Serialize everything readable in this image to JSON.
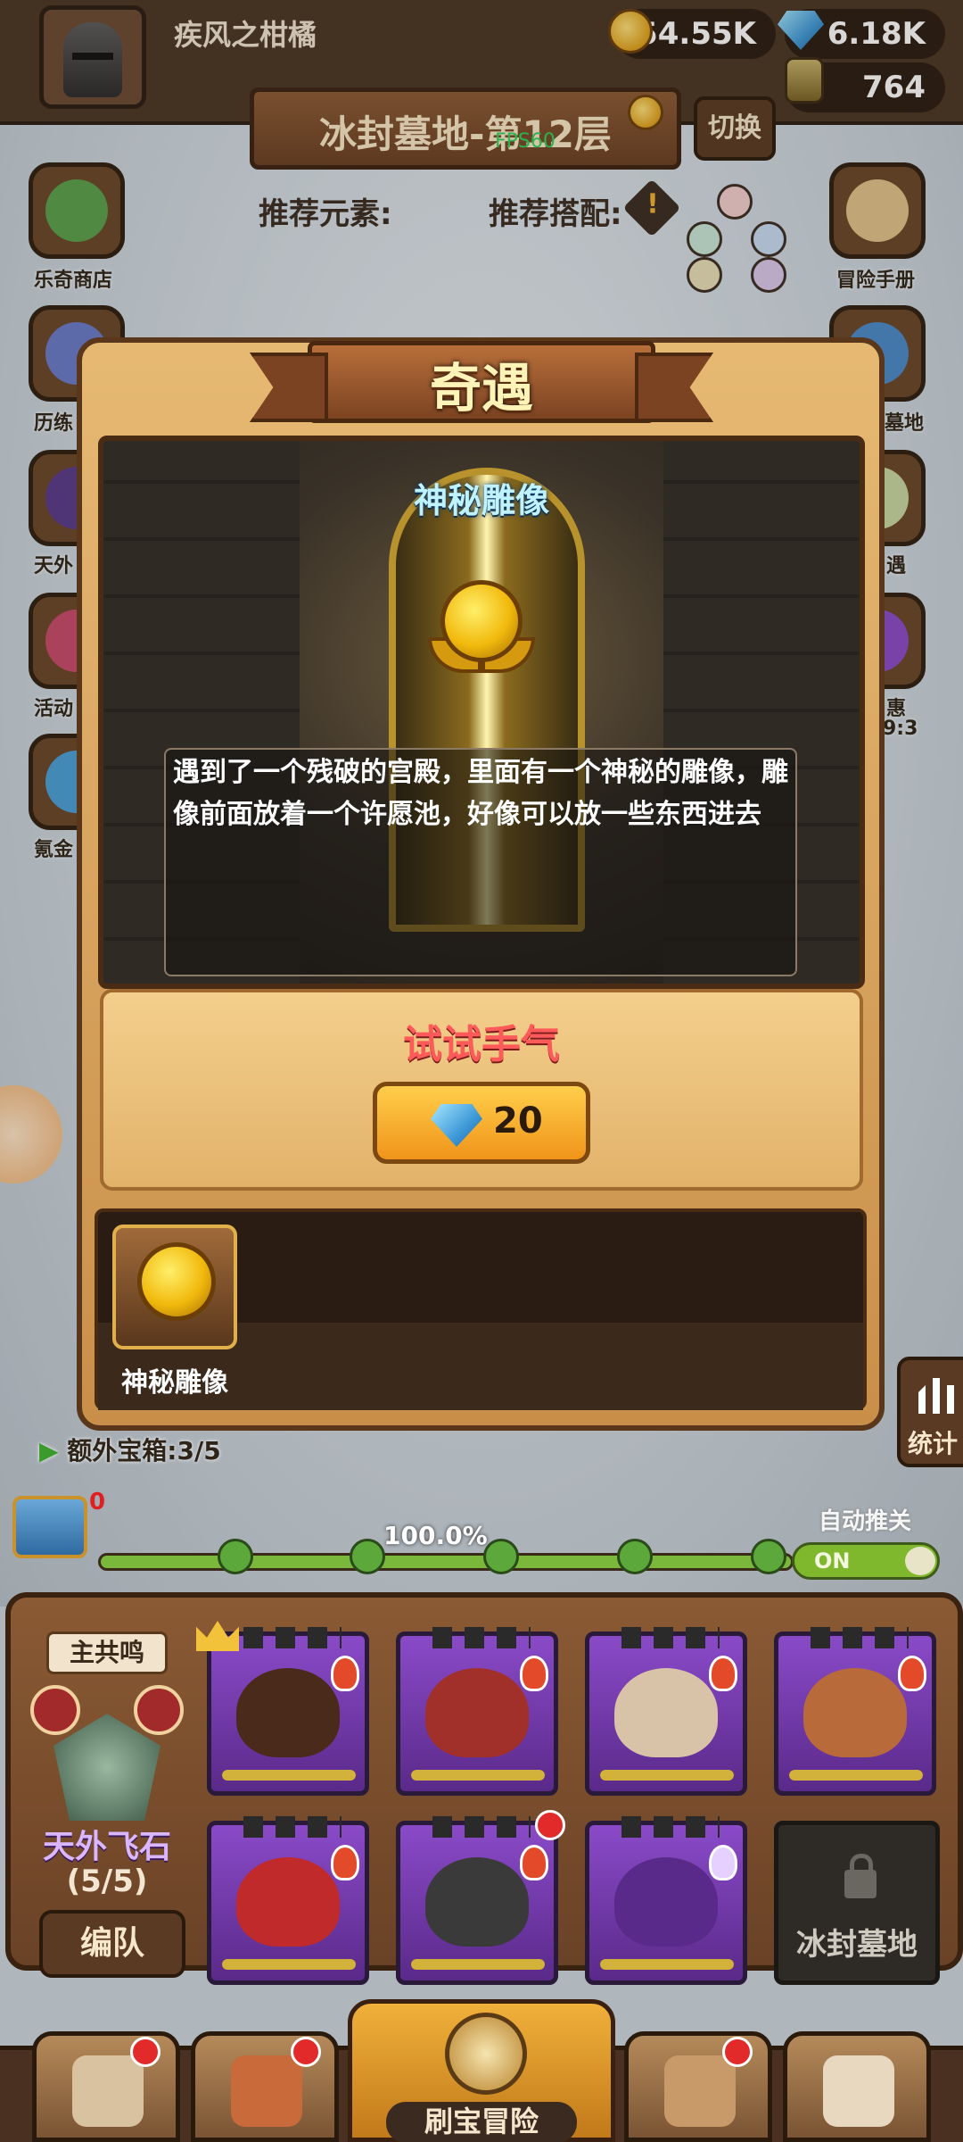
{
  "player": {
    "name": "疾风之柑橘"
  },
  "resources": {
    "gold": "54.55K",
    "gems": "6.18K",
    "potion": "764"
  },
  "level": {
    "title": "冰封墓地-第12层",
    "switch_label": "切换",
    "fps": "FPS60"
  },
  "recommend": {
    "element_label": "推荐元素:",
    "combo_label": "推荐搭配:"
  },
  "side_left": [
    {
      "label": "乐奇商店"
    },
    {
      "label": "历练"
    },
    {
      "label": "天外"
    },
    {
      "label": "活动"
    },
    {
      "label": "氪金"
    }
  ],
  "side_right": [
    {
      "label": "冒险手册"
    },
    {
      "label": "墓地"
    },
    {
      "label": "遇"
    },
    {
      "label": "惠"
    },
    {
      "label": "9:3"
    }
  ],
  "dialog": {
    "title": "奇遇",
    "scene_title": "神秘雕像",
    "description": "遇到了一个残破的宫殿，里面有一个神秘的雕像，雕像前面放着一个许愿池，好像可以放一些东西进去",
    "action_title": "试试手气",
    "cost": "20",
    "item_name": "神秘雕像"
  },
  "stats_label": "统计",
  "progress": {
    "extra_chest": "额外宝箱:3/5",
    "chest_count": "0",
    "percent_text": "100.0%",
    "fraction": 1.0,
    "auto_push_label": "自动推关",
    "toggle_state": "ON"
  },
  "team": {
    "resonance_label": "主共鸣",
    "name": "天外飞石",
    "count": "(5/5)",
    "formation_label": "编队",
    "locked_slot_label": "冰封墓地"
  },
  "nav": {
    "center_label": "刷宝冒险"
  },
  "colors": {
    "accent_gold": "#f0b03a",
    "brown": "#6a4226",
    "title_red": "#ff5a5a",
    "scene_title_blue": "#bff2ff"
  }
}
